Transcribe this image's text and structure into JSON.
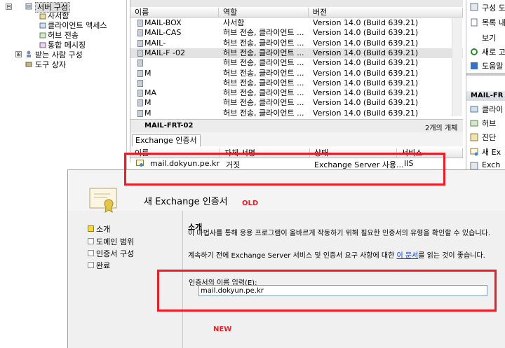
{
  "tree": {
    "items": [
      {
        "label": "서버 구성",
        "expander": "⊟"
      },
      {
        "label": "사서함"
      },
      {
        "label": "클라이언트 액세스"
      },
      {
        "label": "허브 전송"
      },
      {
        "label": "통합 메시징"
      },
      {
        "label": "받는 사람 구성",
        "expander": "⊞"
      },
      {
        "label": "도구 상자"
      }
    ]
  },
  "server_list": {
    "columns": [
      "이름",
      "역할",
      "버전"
    ],
    "rows": [
      {
        "name": "MAIL-BOX",
        "role": "사서함",
        "version": "Version 14.0 (Build 639.21)"
      },
      {
        "name": "MAIL-CAS",
        "role": "허브 전송, 클라이언트 ...",
        "version": "Version 14.0 (Build 639.21)"
      },
      {
        "name": "MAIL-",
        "role": "허브 전송, 클라이언트 ...",
        "version": "Version 14.0 (Build 639.21)"
      },
      {
        "name": "MAIL-F -02",
        "role": "허브 전송, 클라이언트 ...",
        "version": "Version 14.0 (Build 639.21)",
        "selected": true
      },
      {
        "name": "",
        "role": "허브 전송, 클라이언트 ...",
        "version": "Version 14.0 (Build 639.21)"
      },
      {
        "name": "M",
        "role": "허브 전송, 클라이언트 ...",
        "version": "Version 14.0 (Build 639.21)"
      },
      {
        "name": "",
        "role": "허브 전송, 클라이언트 ...",
        "version": "Version 14.0 (Build 639.21)"
      },
      {
        "name": "MA",
        "role": "허브 전송, 클라이언트 ...",
        "version": "Version 14.0 (Build 639.21)"
      },
      {
        "name": "M",
        "role": "허브 전송, 클라이언트 ...",
        "version": "Version 14.0 (Build 639.21)"
      },
      {
        "name": "M",
        "role": "허브 전송, 클라이언트 ...",
        "version": "Version 14.0 (Build 639.21)"
      }
    ],
    "selected_server": "MAIL-FRT-02",
    "object_count": "2개의 개체"
  },
  "cert_pane": {
    "tab": "Exchange 인증서",
    "columns": [
      "이름",
      "자체 서명",
      "상태",
      "서비스"
    ],
    "row": {
      "name": "mail.dokyun.pe.kr",
      "self_signed": "거짓",
      "status": "Exchange Server 사용...",
      "services": "IIS"
    }
  },
  "actions": {
    "items": [
      {
        "label": "구성 도",
        "icon": "config-icon"
      },
      {
        "label": "목록 내",
        "icon": "export-icon"
      },
      {
        "label": "보기",
        "icon": ""
      },
      {
        "label": "새로 고",
        "icon": "refresh-icon"
      },
      {
        "label": "도움말",
        "icon": "help-icon"
      }
    ],
    "section": "MAIL-FR",
    "section_items": [
      {
        "label": "클라이",
        "icon": "client-icon"
      },
      {
        "label": "허브",
        "icon": "hub-icon"
      },
      {
        "label": "진단",
        "icon": "diagnostic-icon"
      },
      {
        "label": "새 Ex",
        "icon": "new-cert-icon"
      },
      {
        "label": "Exch",
        "icon": "exchange-icon"
      }
    ]
  },
  "dialog": {
    "title": "새 Exchange 인증서",
    "steps": [
      {
        "label": "소개",
        "current": true
      },
      {
        "label": "도메인 범위",
        "current": false
      },
      {
        "label": "인증서 구성",
        "current": false
      },
      {
        "label": "완료",
        "current": false
      }
    ],
    "section_title": "소개",
    "description_1": "이 마법사를 통해 응용 프로그램이 올바르게 작동하기 위해 필요한 인증서의 유형을 확인할 수 있습니다.",
    "description_2a": "계속하기 전에 Exchange Server 서비스 및 인증서 요구 사항에 대한 ",
    "description_link": "이 문서",
    "description_2b": "를 읽는 것이 좋습니다.",
    "field_label": "인증서의 이름 입력(E):",
    "field_value": "mail.dokyun.pe.kr"
  },
  "annotations": {
    "old": "OLD",
    "new": "NEW",
    "color": "#ee1c24"
  }
}
